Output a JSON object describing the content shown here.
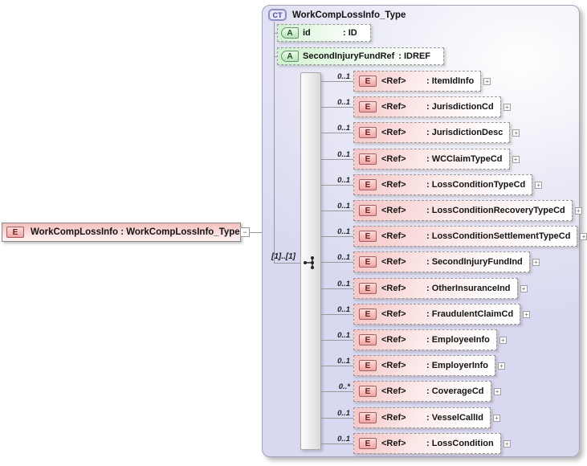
{
  "icons": {
    "element": "E",
    "attribute": "A",
    "complex_type": "CT",
    "expand": "+",
    "collapse": "−",
    "compositor": "sequence-icon"
  },
  "colors": {
    "element_pink": "#f6c5c5",
    "attribute_green": "#cdf2cd",
    "container_lavender": "#d8d8f0",
    "line_gray": "#999999"
  },
  "root_element": {
    "label": "WorkCompLossInfo : WorkCompLossInfo_Type"
  },
  "complex_type": {
    "title": "WorkCompLossInfo_Type",
    "attributes": [
      {
        "name": "id",
        "type_display": ": ID"
      },
      {
        "name": "SecondInjuryFundRef",
        "type_display": ": IDREF"
      }
    ],
    "compositor_cardinality": "[1]..[1]",
    "children": [
      {
        "cardinality": "0..1",
        "ref": "<Ref>",
        "label": ": ItemIdInfo"
      },
      {
        "cardinality": "0..1",
        "ref": "<Ref>",
        "label": ": JurisdictionCd"
      },
      {
        "cardinality": "0..1",
        "ref": "<Ref>",
        "label": ": JurisdictionDesc"
      },
      {
        "cardinality": "0..1",
        "ref": "<Ref>",
        "label": ": WCClaimTypeCd"
      },
      {
        "cardinality": "0..1",
        "ref": "<Ref>",
        "label": ": LossConditionTypeCd"
      },
      {
        "cardinality": "0..1",
        "ref": "<Ref>",
        "label": ": LossConditionRecoveryTypeCd"
      },
      {
        "cardinality": "0..1",
        "ref": "<Ref>",
        "label": ": LossConditionSettlementTypeCd"
      },
      {
        "cardinality": "0..1",
        "ref": "<Ref>",
        "label": ": SecondInjuryFundInd"
      },
      {
        "cardinality": "0..1",
        "ref": "<Ref>",
        "label": ": OtherInsuranceInd"
      },
      {
        "cardinality": "0..1",
        "ref": "<Ref>",
        "label": ": FraudulentClaimCd"
      },
      {
        "cardinality": "0..1",
        "ref": "<Ref>",
        "label": ": EmployeeInfo"
      },
      {
        "cardinality": "0..1",
        "ref": "<Ref>",
        "label": ": EmployerInfo"
      },
      {
        "cardinality": "0..*",
        "ref": "<Ref>",
        "label": ": CoverageCd"
      },
      {
        "cardinality": "0..1",
        "ref": "<Ref>",
        "label": ": VesselCallId"
      },
      {
        "cardinality": "0..1",
        "ref": "<Ref>",
        "label": ": LossCondition"
      }
    ]
  }
}
